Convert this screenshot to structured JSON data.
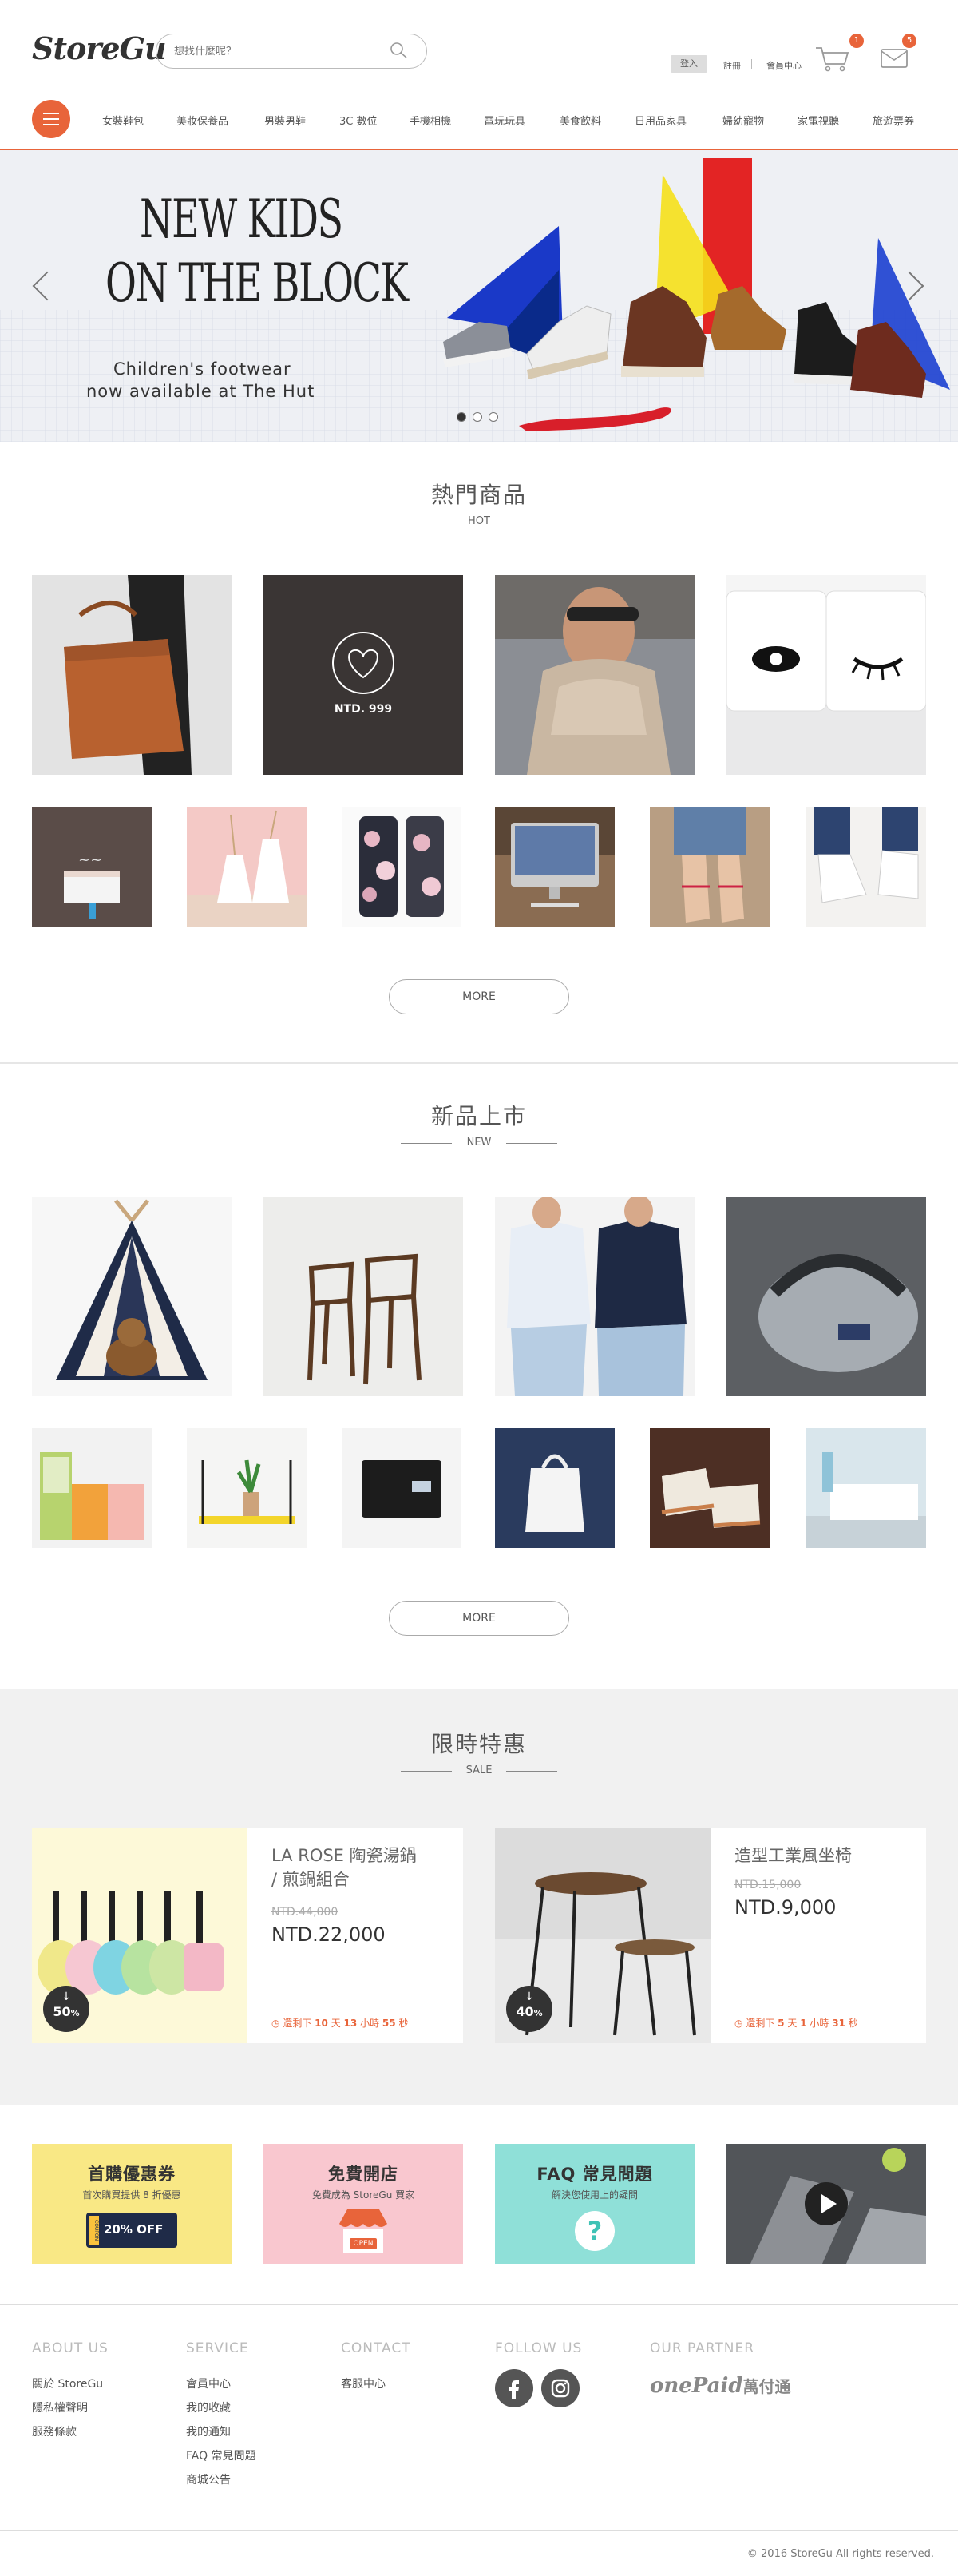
{
  "header": {
    "logo": "StoreGu",
    "search_placeholder": "想找什麼呢？",
    "login": "登入",
    "register": "註冊",
    "member_center": "會員中心",
    "cart_count": "1",
    "mail_count": "5"
  },
  "nav": {
    "categories": [
      "女裝鞋包",
      "美妝保養品",
      "男裝男鞋",
      "3C 數位",
      "手機相機",
      "電玩玩具",
      "美食飲料",
      "日用品家具",
      "婦幼寵物",
      "家電視聽",
      "旅遊票券"
    ]
  },
  "hero": {
    "title_line1": "NEW KIDS",
    "title_line2": "ON THE BLOCK",
    "subtitle_line1": "Children's footwear",
    "subtitle_line2": "now available at The Hut",
    "slide_count": 3,
    "active_slide": 1
  },
  "hot": {
    "title": "熱門商品",
    "subtitle": "HOT",
    "overlay_price": "NTD. 999",
    "more": "MORE"
  },
  "new": {
    "title": "新品上市",
    "subtitle": "NEW",
    "more": "MORE"
  },
  "sale": {
    "title": "限時特惠",
    "subtitle": "SALE",
    "items": [
      {
        "name_line1": "LA ROSE 陶瓷湯鍋",
        "name_line2": "/ 煎鍋組合",
        "old_price": "NTD.44,000",
        "new_price": "NTD.22,000",
        "discount": "50",
        "timer_prefix": "還剩下",
        "days": "10",
        "day_unit": "天",
        "hours": "13",
        "hour_unit": "小時",
        "seconds": "55",
        "sec_unit": "秒"
      },
      {
        "name_line1": "造型工業風坐椅",
        "name_line2": "",
        "old_price": "NTD.15,000",
        "new_price": "NTD.9,000",
        "discount": "40",
        "timer_prefix": "還剩下",
        "days": "5",
        "day_unit": "天",
        "hours": "1",
        "hour_unit": "小時",
        "seconds": "31",
        "sec_unit": "秒"
      }
    ]
  },
  "promos": [
    {
      "title": "首購優惠券",
      "desc": "首次購買提供 8 折優惠",
      "coupon": "20% OFF",
      "coupon_side": "COUPON",
      "color": "#f9e885"
    },
    {
      "title": "免費開店",
      "desc": "免費成為 StoreGu 買家",
      "badge": "OPEN",
      "color": "#f9c7cf"
    },
    {
      "title": "FAQ 常見問題",
      "desc": "解決您使用上的疑問",
      "icon": "?",
      "color": "#8fe0d8"
    }
  ],
  "footer": {
    "about": {
      "heading": "ABOUT US",
      "links": [
        "關於 StoreGu",
        "隱私權聲明",
        "服務條款"
      ]
    },
    "service": {
      "heading": "SERVICE",
      "links": [
        "會員中心",
        "我的收藏",
        "我的通知",
        "FAQ 常見問題",
        "商城公告"
      ]
    },
    "contact": {
      "heading": "CONTACT",
      "links": [
        "客服中心"
      ]
    },
    "follow": {
      "heading": "FOLLOW US"
    },
    "partner": {
      "heading": "OUR PARTNER",
      "name": "onePaid",
      "name_cn": "萬付通"
    },
    "copyright": "© 2016 StoreGu All rights reserved."
  },
  "colors": {
    "accent": "#e8643a",
    "text": "#555555",
    "sale_bg": "#f1f1f1"
  }
}
